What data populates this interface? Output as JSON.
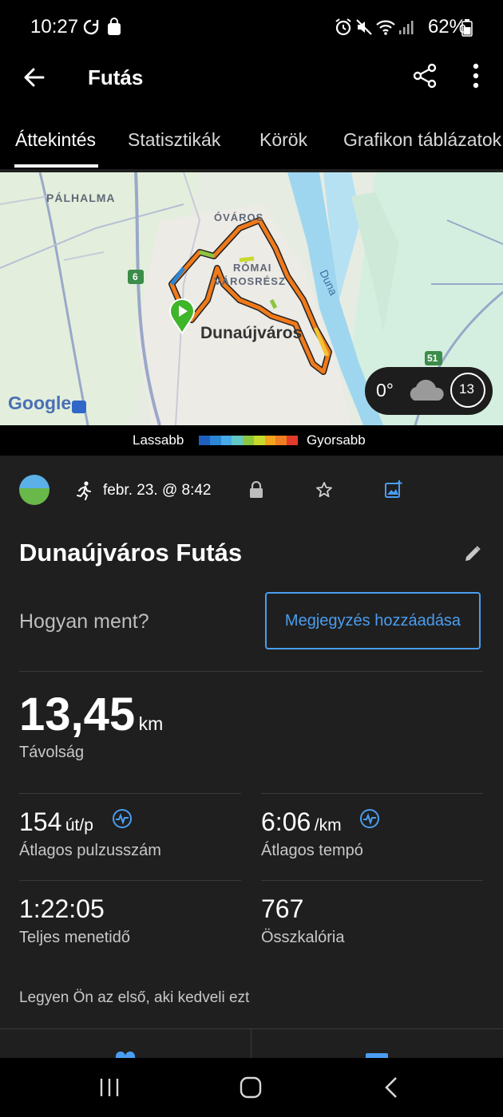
{
  "status_bar": {
    "time": "10:27",
    "battery": "62%"
  },
  "header": {
    "title": "Futás"
  },
  "tabs": [
    {
      "label": "Áttekintés",
      "active": true
    },
    {
      "label": "Statisztikák",
      "active": false
    },
    {
      "label": "Körök",
      "active": false
    },
    {
      "label": "Grafikon táblázatok",
      "active": false
    }
  ],
  "map": {
    "labels": {
      "palhalma": "PÁLHALMA",
      "ovaros": "ÓVÁROS",
      "romai1": "RÓMAI",
      "romai2": "VÁROSRÉSZ",
      "city": "Dunaújváros",
      "river": "Duna",
      "road6": "6",
      "road51": "51",
      "google": "Google"
    },
    "weather": {
      "temp": "0°",
      "wind": "13"
    }
  },
  "legend": {
    "slower": "Lassabb",
    "faster": "Gyorsabb",
    "colors": [
      "#1f5fbf",
      "#2b86d6",
      "#47a9e6",
      "#62c7c7",
      "#8cc63f",
      "#c7d92c",
      "#f4a21d",
      "#ef7d22",
      "#e23b2a"
    ]
  },
  "activity": {
    "date": "febr. 23. @ 8:42",
    "title": "Dunaújváros Futás",
    "how_prompt": "Hogyan ment?",
    "add_note": "Megjegyzés hozzáadása"
  },
  "stats": {
    "distance": {
      "value": "13,45",
      "unit": "km",
      "label": "Távolság"
    },
    "heart_rate": {
      "value": "154",
      "unit": "út/p",
      "label": "Átlagos pulzusszám"
    },
    "pace": {
      "value": "6:06",
      "unit": "/km",
      "label": "Átlagos tempó"
    },
    "duration": {
      "value": "1:22:05",
      "label": "Teljes menetidő"
    },
    "calories": {
      "value": "767",
      "label": "Összkalória"
    }
  },
  "likes_text": "Legyen Ön az első, aki kedveli ezt",
  "colors": {
    "accent": "#4a9df0",
    "background": "#1f1f1f",
    "route": "#f07a1a"
  }
}
